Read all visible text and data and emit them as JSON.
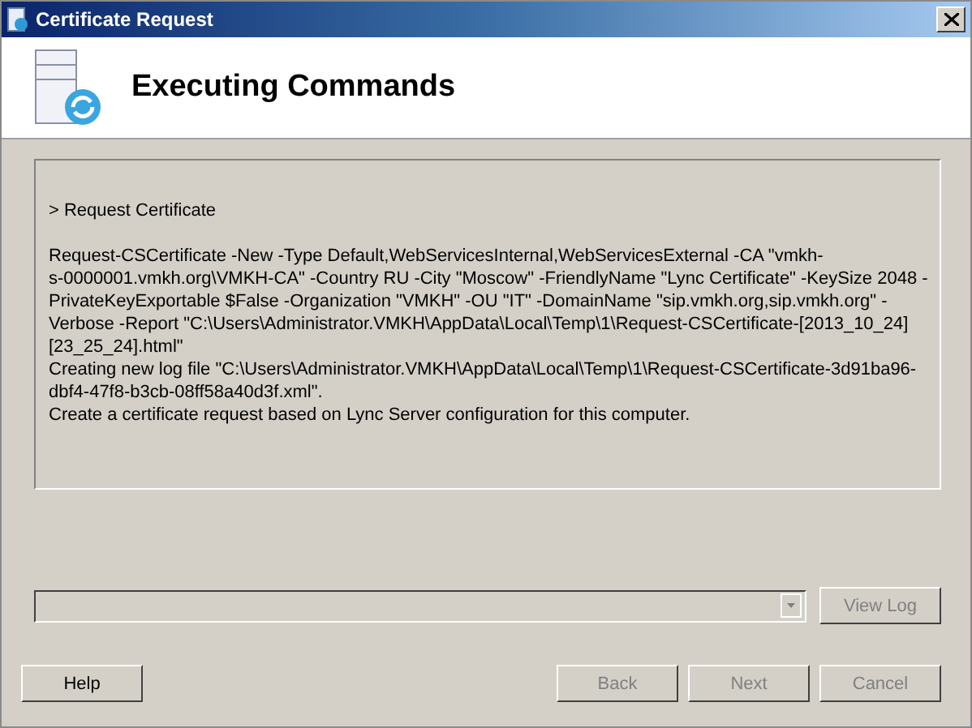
{
  "window": {
    "title": "Certificate Request"
  },
  "header": {
    "title": "Executing Commands"
  },
  "output": {
    "prompt": "> Request Certificate",
    "lines": [
      "Request-CSCertificate -New -Type Default,WebServicesInternal,WebServicesExternal -CA \"vmkh-",
      "s-0000001.vmkh.org\\VMKH-CA\" -Country RU -City \"Moscow\" -FriendlyName \"Lync Certificate\" -KeySize 2048 -",
      "PrivateKeyExportable $False -Organization \"VMKH\" -OU \"IT\" -DomainName \"sip.vmkh.org,sip.vmkh.org\" -",
      "Verbose -Report \"C:\\Users\\Administrator.VMKH\\AppData\\Local\\Temp\\1\\Request-CSCertificate-[2013_10_24]",
      "[23_25_24].html\"",
      "Creating new log file \"C:\\Users\\Administrator.VMKH\\AppData\\Local\\Temp\\1\\Request-CSCertificate-3d91ba96-",
      "dbf4-47f8-b3cb-08ff58a40d3f.xml\".",
      "Create a certificate request based on Lync Server configuration for this computer."
    ]
  },
  "log_select": {
    "disabled": true
  },
  "view_log_button": {
    "label": "View Log",
    "disabled": true
  },
  "buttons": [
    {
      "label": "Help",
      "disabled": false
    },
    {
      "label": "Back",
      "disabled": true
    },
    {
      "label": "Next",
      "disabled": true
    },
    {
      "label": "Cancel",
      "disabled": true
    }
  ]
}
